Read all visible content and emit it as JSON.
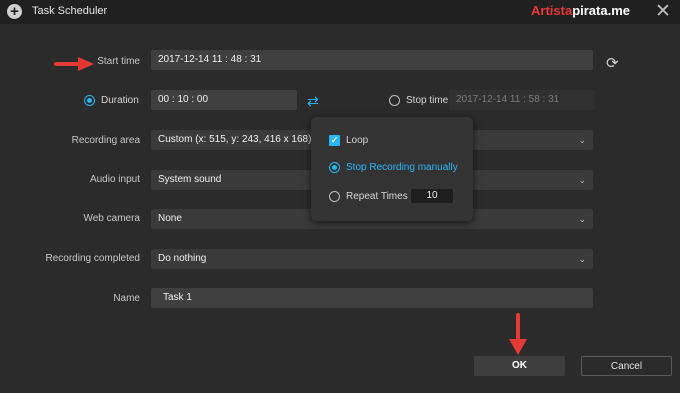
{
  "window": {
    "title": "Task Scheduler",
    "watermark_a": "Artista",
    "watermark_b": "pirata.me"
  },
  "start_time": {
    "label": "Start time",
    "value": "2017-12-14 11 : 48 : 31"
  },
  "duration": {
    "label": "Duration",
    "value": "00 : 10 : 00",
    "selected": true
  },
  "stop_time": {
    "label": "Stop time",
    "value": "2017-12-14 11 : 58 : 31",
    "selected": false
  },
  "recording_area": {
    "label": "Recording area",
    "value": "Custom (x: 515, y: 243, 416 x 168)"
  },
  "audio_input": {
    "label": "Audio input",
    "value": "System sound"
  },
  "web_camera": {
    "label": "Web camera",
    "value": "None"
  },
  "recording_completed": {
    "label": "Recording completed",
    "value": "Do nothing"
  },
  "name": {
    "label": "Name",
    "value": "Task 1"
  },
  "popup": {
    "loop_label": "Loop",
    "loop_checked": true,
    "stop_manual_label": "Stop Recording manually",
    "stop_manual_selected": true,
    "repeat_label": "Repeat Times",
    "repeat_value": "10"
  },
  "buttons": {
    "ok": "OK",
    "cancel": "Cancel"
  },
  "colors": {
    "accent": "#29b6f6",
    "arrow": "#e53935",
    "background": "#2b2b2b"
  },
  "icons": [
    "add-circle-icon",
    "close-icon",
    "refresh-icon",
    "swap-icon",
    "chevron-down-icon",
    "checkbox-check-icon",
    "annotation-arrow-icon"
  ]
}
